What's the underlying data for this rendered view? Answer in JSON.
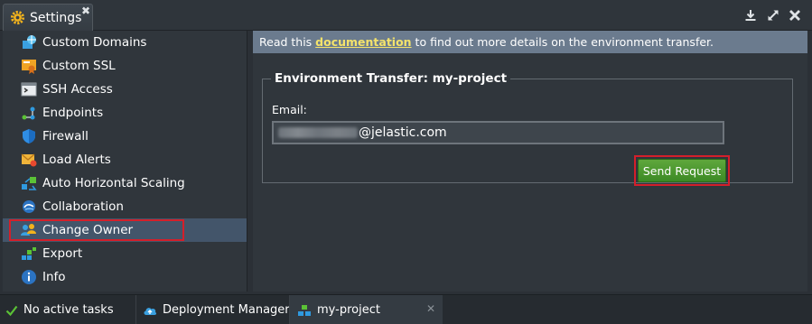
{
  "window": {
    "tab_title": "Settings",
    "close_glyph": "✖"
  },
  "sidebar": {
    "items": [
      {
        "label": "Custom Domains",
        "icon": "custom-domains-icon"
      },
      {
        "label": "Custom SSL",
        "icon": "ssl-certificate-icon"
      },
      {
        "label": "SSH Access",
        "icon": "terminal-icon"
      },
      {
        "label": "Endpoints",
        "icon": "endpoints-icon"
      },
      {
        "label": "Firewall",
        "icon": "shield-icon"
      },
      {
        "label": "Load Alerts",
        "icon": "envelope-icon"
      },
      {
        "label": "Auto Horizontal Scaling",
        "icon": "scaling-icon"
      },
      {
        "label": "Collaboration",
        "icon": "handshake-icon"
      },
      {
        "label": "Change Owner",
        "icon": "change-owner-icon",
        "selected": true
      },
      {
        "label": "Export",
        "icon": "export-icon"
      },
      {
        "label": "Info",
        "icon": "info-icon"
      }
    ]
  },
  "main": {
    "info_prefix": "Read this ",
    "info_link": "documentation",
    "info_suffix": " to find out more details on the environment transfer.",
    "form": {
      "legend": "Environment Transfer: my-project",
      "email_label": "Email:",
      "email_domain": "@jelastic.com",
      "send_label": "Send Request"
    }
  },
  "taskbar": {
    "status": "No active tasks",
    "deployment_manager": "Deployment Manager",
    "project": "my-project",
    "close_glyph": "✕"
  },
  "colors": {
    "accent_link": "#f4e36b",
    "highlight_red": "#d41f2a",
    "button_green": "#4e9a2f",
    "selected_row": "#43556a"
  }
}
